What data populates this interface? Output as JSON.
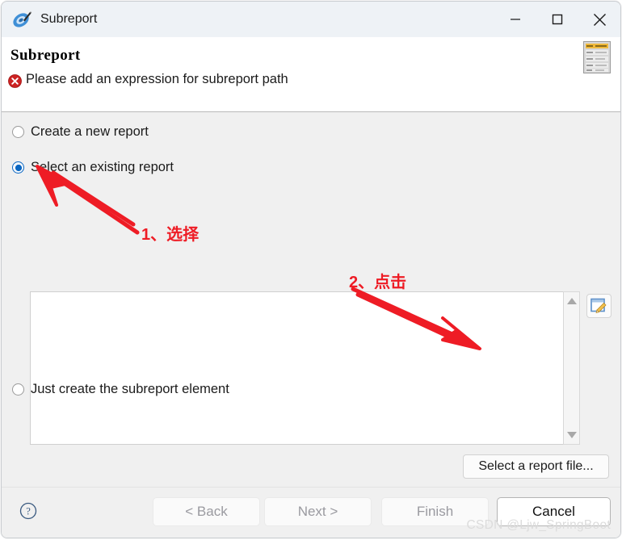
{
  "window": {
    "title": "Subreport",
    "app_icon": "jaspersoft-studio-icon",
    "controls": {
      "minimize": "minimize-icon",
      "maximize": "maximize-icon",
      "close": "close-icon"
    }
  },
  "header": {
    "title": "Subreport",
    "message": "Please add an expression for subreport path",
    "status_icon": "error-icon",
    "status_color": "#cc2222",
    "banner_icon": "report-wizard-icon"
  },
  "options": [
    {
      "label": "Create a new report",
      "selected": false
    },
    {
      "label": "Select an existing report",
      "selected": true
    },
    {
      "label": "Just create the subreport element",
      "selected": false
    }
  ],
  "report_list": {
    "items": [],
    "scrollbar": {
      "up_arrow": "chevron-up-icon",
      "down_arrow": "chevron-down-icon"
    },
    "expression_button_icon": "expression-editor-icon"
  },
  "buttons": {
    "select_file": "Select a report file...",
    "help": "help-icon",
    "back": "< Back",
    "next": "Next >",
    "finish": "Finish",
    "cancel": "Cancel"
  },
  "annotations": {
    "accent_color": "#ee1c25",
    "step1": "1、选择",
    "step2": "2、点击"
  },
  "watermark": "CSDN @Ljw_SpringBoot"
}
